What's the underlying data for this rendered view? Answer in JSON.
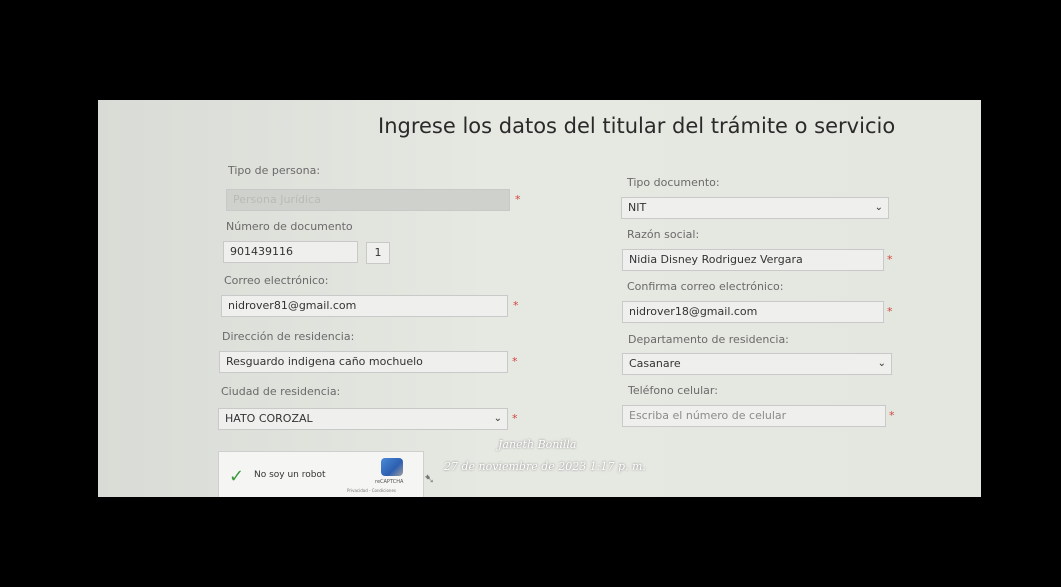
{
  "form": {
    "title": "Ingrese los datos del titular del trámite o servicio",
    "tipo_persona": {
      "label": "Tipo de persona:",
      "value": "Persona Jurídica"
    },
    "tipo_documento": {
      "label": "Tipo documento:",
      "value": "NIT"
    },
    "numero_documento": {
      "label": "Número de documento",
      "value": "901439116",
      "check_digit": "1"
    },
    "razon_social": {
      "label": "Razón social:",
      "value": "Nidia Disney Rodriguez Vergara"
    },
    "correo": {
      "label": "Correo electrónico:",
      "value": "nidrover81@gmail.com"
    },
    "confirma_correo": {
      "label": "Confirma correo electrónico:",
      "value": "nidrover18@gmail.com"
    },
    "direccion": {
      "label": "Dirección de residencia:",
      "value": "Resguardo indigena caño mochuelo"
    },
    "departamento": {
      "label": "Departamento de residencia:",
      "value": "Casanare"
    },
    "ciudad": {
      "label": "Ciudad de residencia:",
      "value": "HATO COROZAL"
    },
    "telefono": {
      "label": "Teléfono celular:",
      "placeholder": "Escriba el número de celular"
    },
    "required_mark": "*"
  },
  "captcha": {
    "label": "No soy un robot",
    "brand": "reCAPTCHA",
    "links": "Privacidad - Condiciones",
    "check_icon": "✓"
  },
  "watermark": {
    "name": "Janeth Bonilla",
    "date": "27 de noviembre de 2023 1:17 p. m."
  },
  "icons": {
    "chevron": "⌄",
    "cursor": "➷"
  }
}
